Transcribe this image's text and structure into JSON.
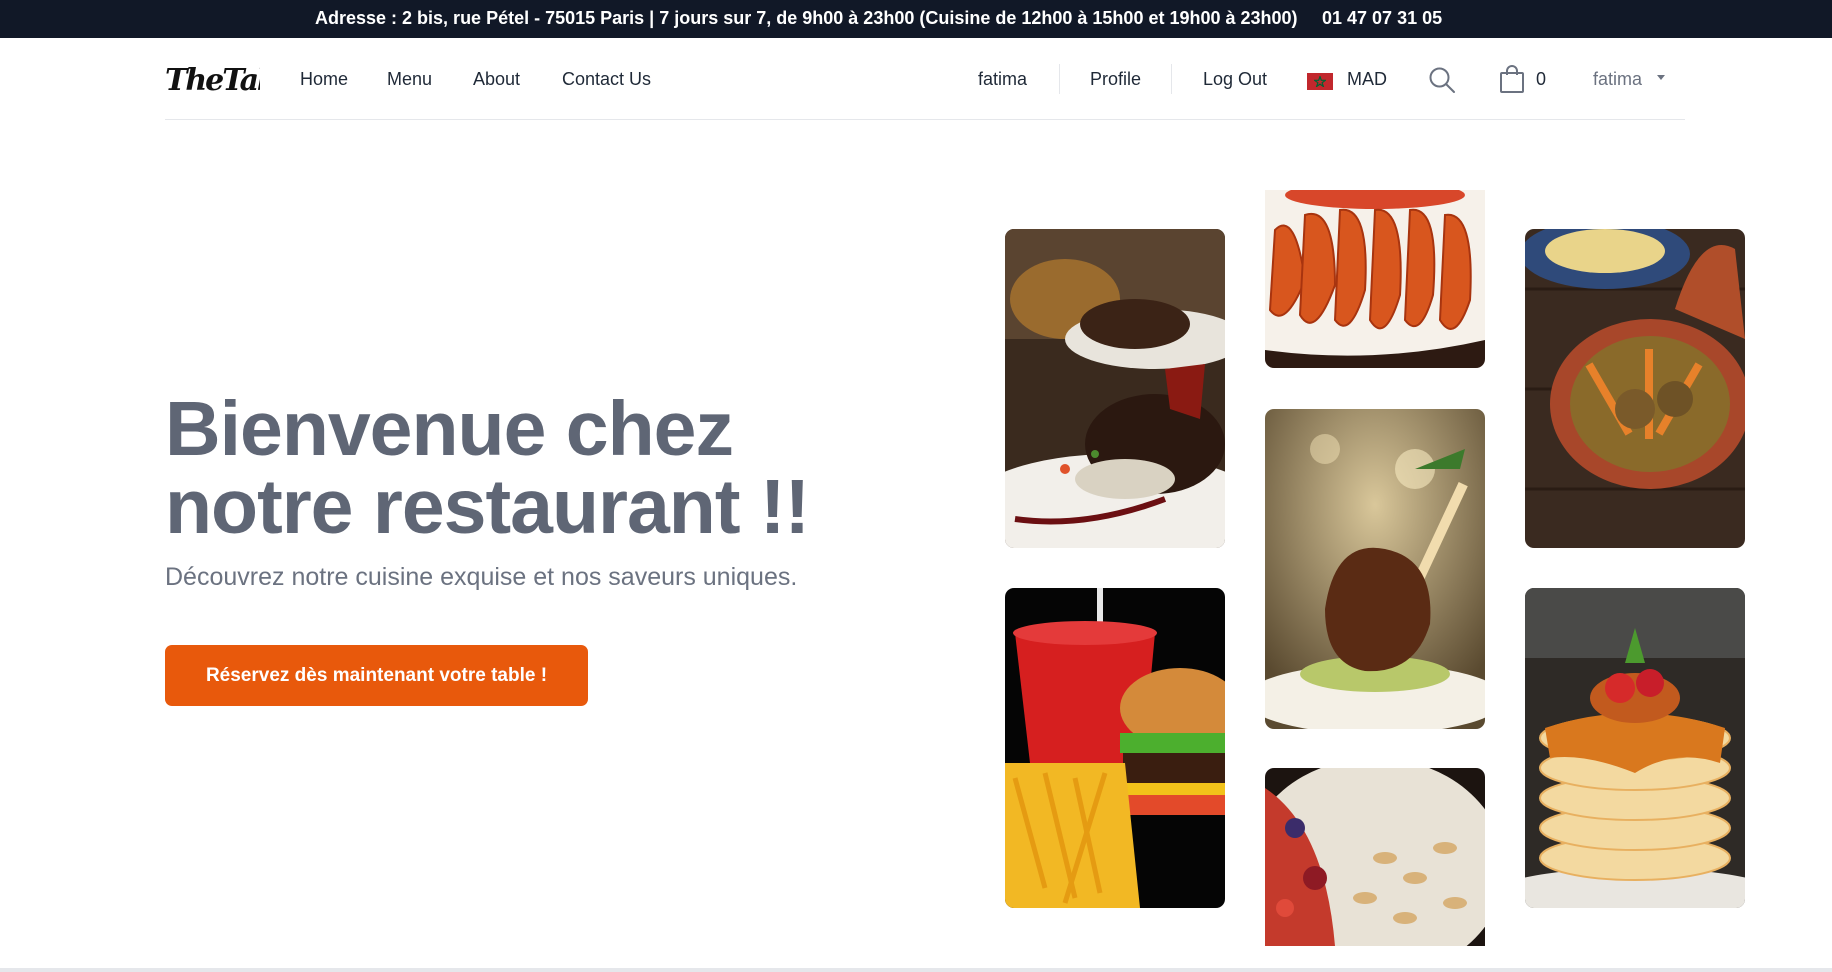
{
  "topbar": {
    "address": "Adresse : 2 bis, rue Pétel - 75015 Paris | 7 jours sur 7, de 9h00 à 23h00 (Cuisine de 12h00 à 15h00 et 19h00 à 23h00)",
    "phone": "01 47 07 31 05"
  },
  "nav": {
    "logo_text": "TheTable",
    "links": [
      "Home",
      "Menu",
      "About",
      "Contact Us"
    ],
    "user_name": "fatima",
    "profile": "Profile",
    "logout": "Log Out",
    "currency": "MAD",
    "cart_count": "0",
    "account_menu": "fatima"
  },
  "hero": {
    "title": "Bienvenue chez notre restaurant !!",
    "subtitle": "Découvrez notre cuisine exquise et nos saveurs uniques.",
    "cta": "Réservez dès maintenant votre table !"
  },
  "gallery": [
    "steak-dish-photo",
    "burger-fries-photo",
    "grilled-shrimp-photo",
    "lamb-shank-photo",
    "nut-fruit-bowl-photo",
    "tajine-photo",
    "pancakes-photo"
  ],
  "colors": {
    "topbar_bg": "#111827",
    "accent": "#e8590c",
    "title": "#5f6675",
    "text": "#1f2937",
    "muted": "#6b7280"
  }
}
